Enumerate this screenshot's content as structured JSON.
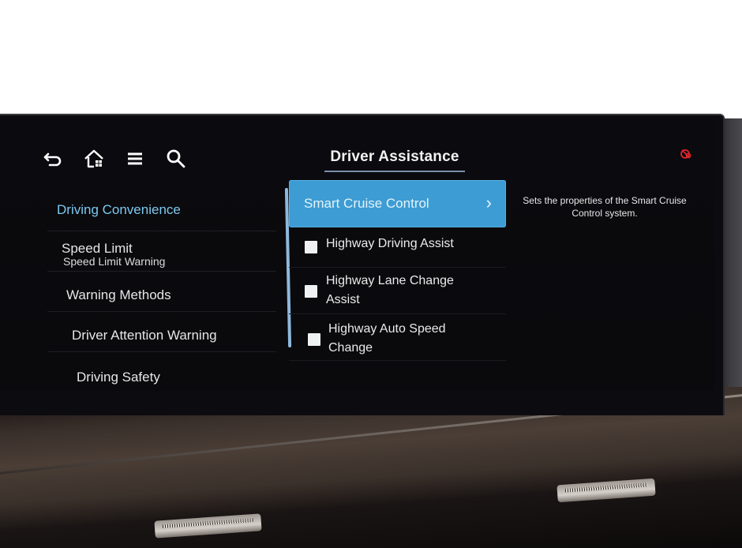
{
  "toolbar": {
    "icons": [
      "back-icon",
      "home-icon",
      "menu-icon",
      "search-icon"
    ]
  },
  "header": {
    "title": "Driver Assistance",
    "status_icon": "connectivity-off-icon",
    "status_color": "#e0262a"
  },
  "left_menu": {
    "items": [
      {
        "label": "Driving Convenience",
        "active": true
      },
      {
        "label": "Speed Limit",
        "sub": "Speed Limit Warning"
      },
      {
        "label": "Warning Methods"
      },
      {
        "label": "Driver Attention Warning"
      },
      {
        "label": "Driving Safety"
      }
    ],
    "active_color": "#7cc9f0"
  },
  "center_list": {
    "selected": {
      "label": "Smart Cruise Control",
      "chevron": "›"
    },
    "items": [
      {
        "label": "Highway Driving Assist",
        "checked": false
      },
      {
        "label": "Highway Lane Change Assist",
        "checked": false
      },
      {
        "label": "Highway Auto Speed Change",
        "checked": false
      }
    ],
    "accent": "#3d9cd3"
  },
  "description": "Sets the properties of the Smart Cruise Control system."
}
